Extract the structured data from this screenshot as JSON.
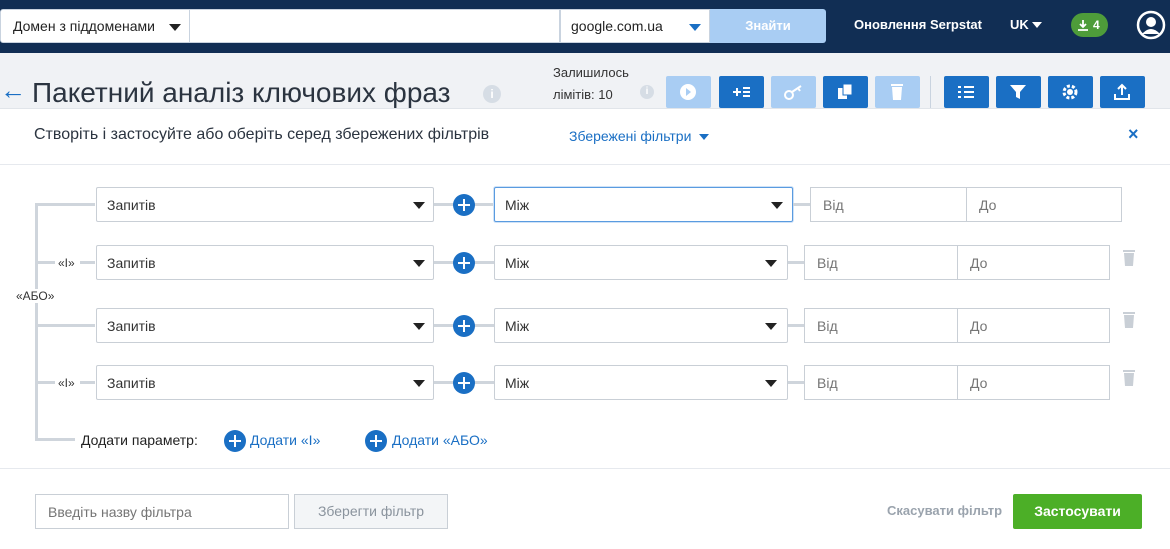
{
  "topbar": {
    "search_type": "Домен з піддоменами",
    "search_value": "",
    "engine": "google.com.ua",
    "find_label": "Знайти",
    "updates_label": "Оновлення Serpstat",
    "language": "UK",
    "downloads_count": "4"
  },
  "header": {
    "title": "Пакетний аналіз ключових фраз",
    "info": "i",
    "limits_line1": "Залишилось",
    "limits_line2": "лімітів: 10"
  },
  "toolbar": {
    "group1": [
      "play-icon",
      "add-list-icon",
      "key-icon",
      "copy-icon",
      "trash-icon"
    ],
    "group2": [
      "columns-icon",
      "filter-icon",
      "gear-icon",
      "export-icon"
    ],
    "active_color": "#1a6fc4",
    "disabled_color": "#a9cdf3"
  },
  "filter_panel": {
    "title": "Створіть і застосуйте або оберіть серед збережених фільтрів",
    "saved_filters_label": "Збережені фільтри",
    "close_label": "×",
    "or_label": "«АБО»",
    "and_label": "«І»",
    "rows": [
      {
        "param": "Запитів",
        "condition": "Між",
        "from_placeholder": "Від",
        "to_placeholder": "До"
      },
      {
        "param": "Запитів",
        "condition": "Між",
        "from_placeholder": "Від",
        "to_placeholder": "До"
      },
      {
        "param": "Запитів",
        "condition": "Між",
        "from_placeholder": "Від",
        "to_placeholder": "До"
      },
      {
        "param": "Запитів",
        "condition": "Між",
        "from_placeholder": "Від",
        "to_placeholder": "До"
      }
    ],
    "add_param_label": "Додати параметр:",
    "add_and_label": "Додати «І»",
    "add_or_label": "Додати «АБО»",
    "filter_name_placeholder": "Введіть назву фільтра",
    "save_filter_label": "Зберегти фільтр",
    "cancel_filter_label": "Скасувати фільтр",
    "apply_label": "Застосувати"
  }
}
